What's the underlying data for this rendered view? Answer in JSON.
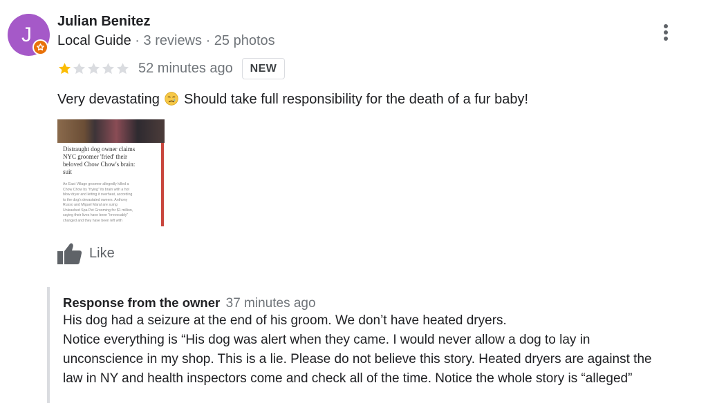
{
  "reviewer": {
    "avatar_letter": "J",
    "name": "Julian Benitez",
    "guide_label": "Local Guide",
    "separator": " · ",
    "reviews": "3 reviews",
    "photos": "25 photos"
  },
  "review": {
    "rating": 1,
    "max_rating": 5,
    "time": "52 minutes ago",
    "badge": "NEW",
    "text_before_emoji": "Very devastating",
    "emoji": "crying-face",
    "text_after_emoji": "Should take full responsibility for the death of a fur baby!",
    "photo": {
      "headline": "Distraught dog owner claims\nNYC groomer 'fried' their\nbeloved Chow Chow's brain:\nsuit",
      "body": "An East Village groomer allegedly killed a\nChow Chow by \"frying\" its brain with a hot\nblow dryer and letting it overheat, according\nto the dog's devastated owners. Anthony\nRusso and Miguel Maral are suing\nUnleashed Spa Pet Grooming for $1 million,\nsaying their lives have been \"irrevocably\"\nchanged and they have been left with"
    },
    "like_label": "Like"
  },
  "owner_response": {
    "title": "Response from the owner",
    "time": "37 minutes ago",
    "lines": [
      "His dog had a seizure at the end of his groom. We don’t have heated dryers.",
      "Notice everything is “His dog was alert when they came. I would never allow a dog to lay in",
      "unconscience in my shop. This is a lie. Please do not believe this story. Heated dryers are against the",
      "law in NY and health inspectors come and check all of the time. Notice the whole story is “alleged”"
    ]
  },
  "colors": {
    "avatar_bg": "#a559c8",
    "guide_badge": "#e8710a",
    "star_filled": "#fbbc04",
    "star_empty": "#dadce0",
    "muted_text": "#70757a",
    "response_border": "#dadce0"
  },
  "icons": {
    "menu": "more-vert-icon",
    "like": "thumbs-up-icon",
    "guide_badge": "local-guide-star-icon"
  }
}
